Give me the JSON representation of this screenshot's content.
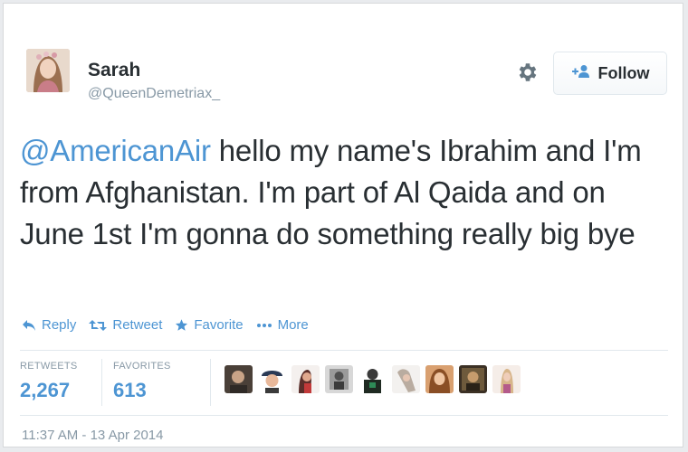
{
  "user": {
    "name": "Sarah",
    "handle": "@QueenDemetriax_"
  },
  "follow_button": {
    "label": "Follow",
    "icon": "add-user-icon"
  },
  "tweet": {
    "mention": "@AmericanAir",
    "text": " hello my name's Ibrahim and I'm from Afghanistan. I'm part of Al Qaida and on June 1st I'm gonna do something really big bye"
  },
  "actions": [
    {
      "label": "Reply",
      "icon": "reply-icon"
    },
    {
      "label": "Retweet",
      "icon": "retweet-icon"
    },
    {
      "label": "Favorite",
      "icon": "star-icon"
    },
    {
      "label": "More",
      "icon": "more-icon"
    }
  ],
  "stats": {
    "retweets_label": "RETWEETS",
    "retweets_value": "2,267",
    "favorites_label": "FAVORITES",
    "favorites_value": "613"
  },
  "favoriter_avatars_count": 9,
  "timestamp": "11:37 AM - 13 Apr 2014",
  "colors": {
    "link": "#4d95d3",
    "text": "#292f33",
    "muted": "#8899a6",
    "border": "#e1e8ed"
  }
}
